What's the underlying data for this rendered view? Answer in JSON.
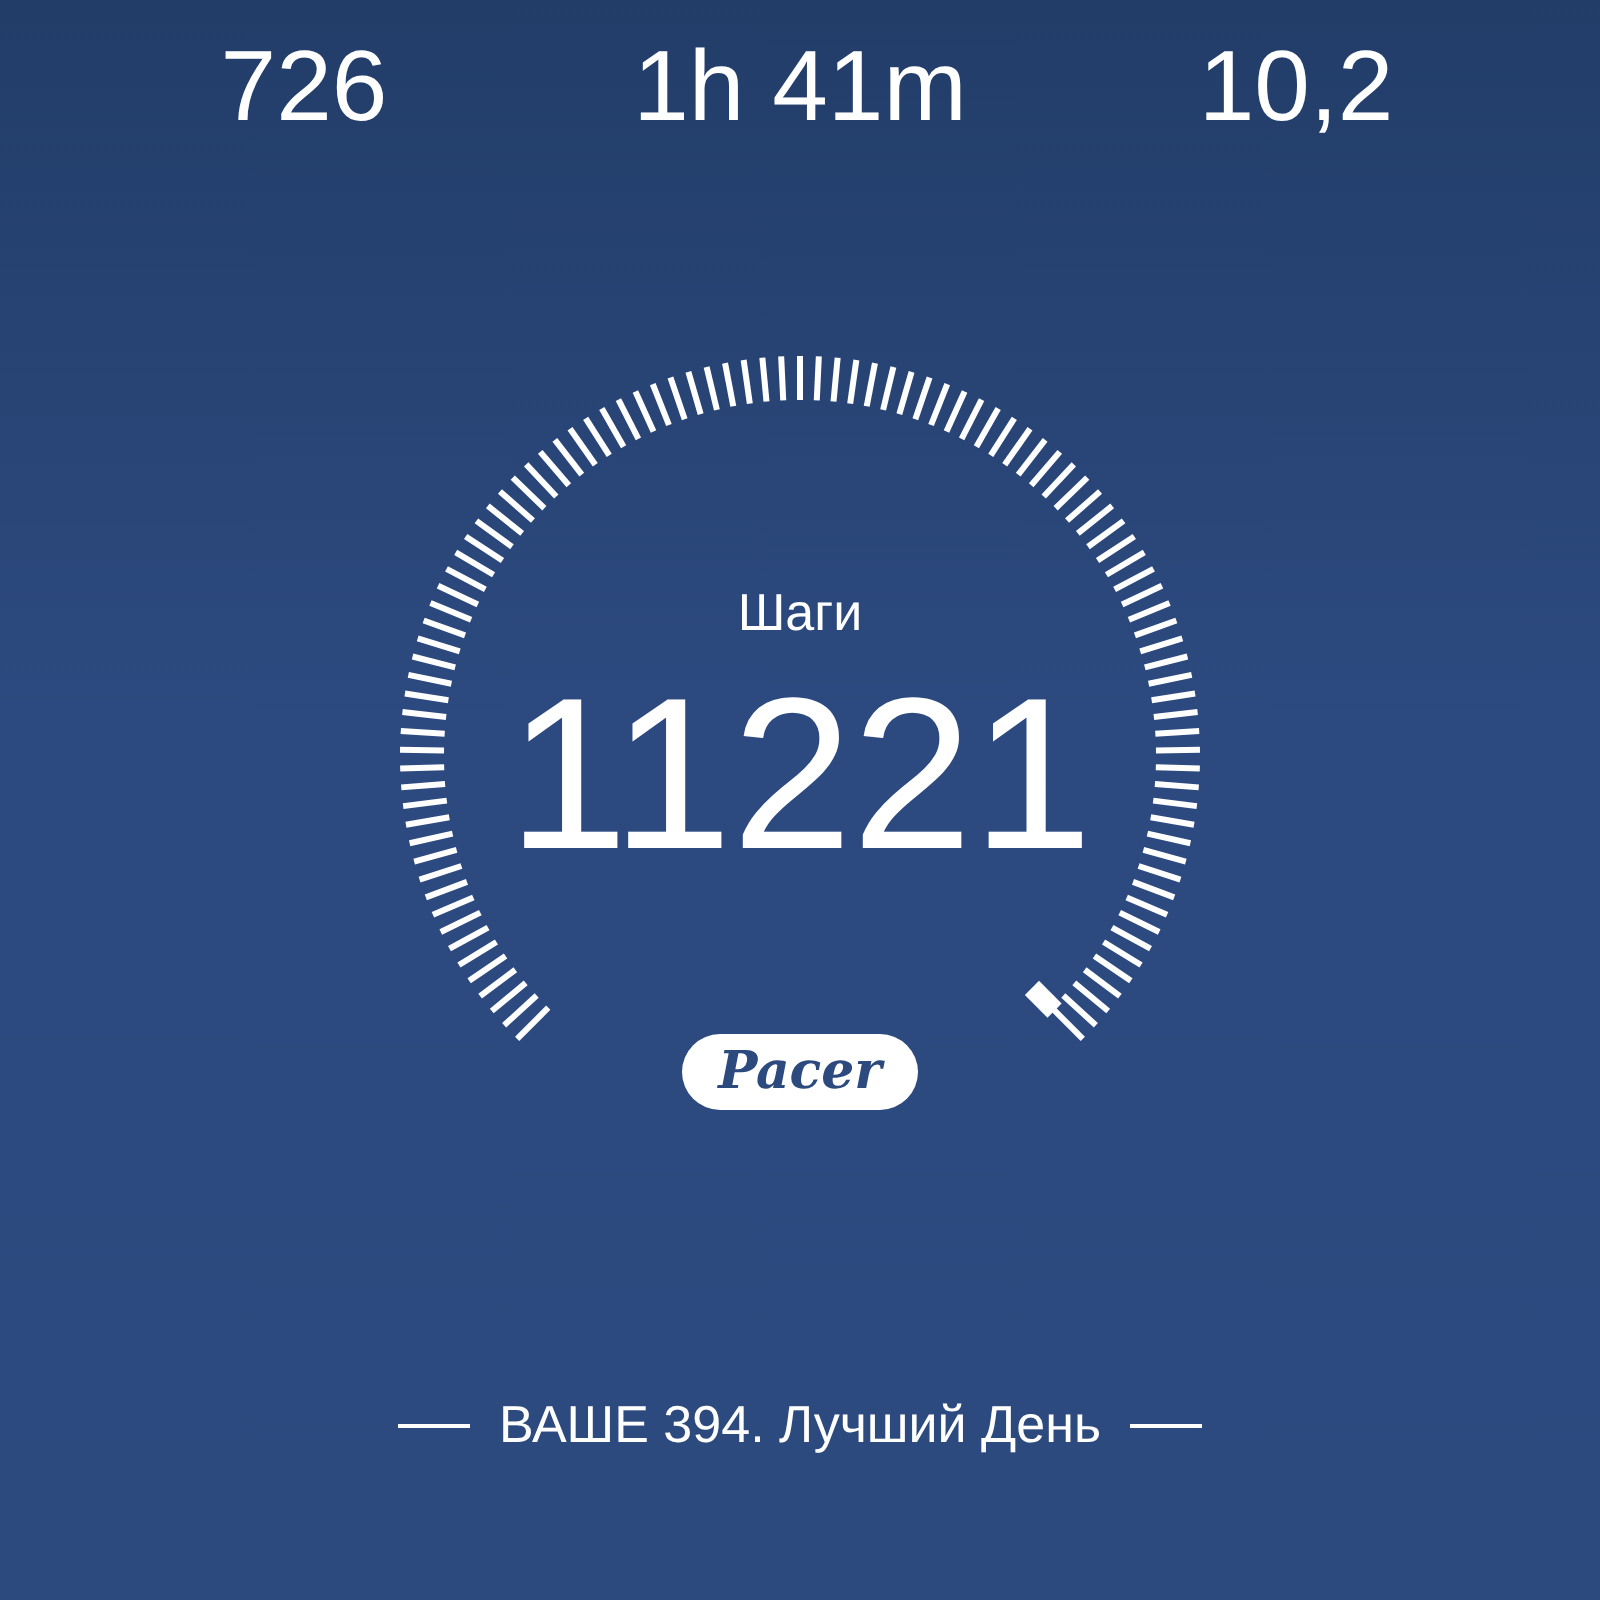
{
  "stats": [
    {
      "value": "726"
    },
    {
      "value": "1h 41m"
    },
    {
      "value": "10,2"
    }
  ],
  "gauge": {
    "label": "Шаги",
    "value": "11221"
  },
  "logo": {
    "text": "Pacer"
  },
  "footer": {
    "text": "ВАШЕ 394. Лучший День"
  }
}
